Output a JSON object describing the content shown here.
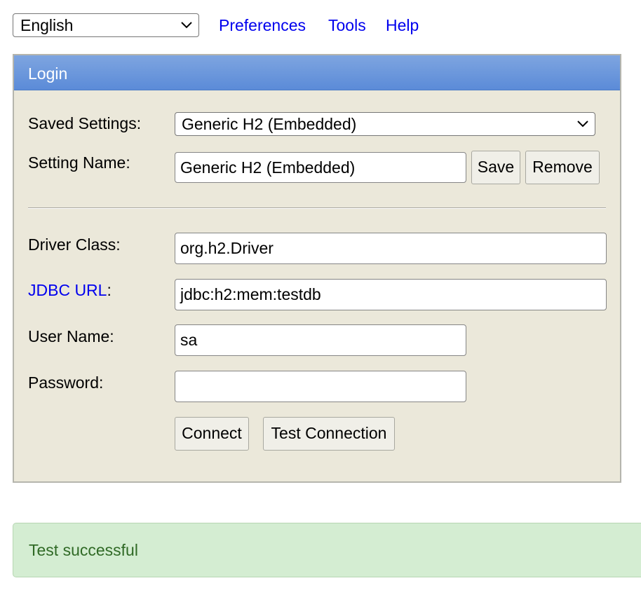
{
  "language_select": {
    "value": "English"
  },
  "nav_links": {
    "preferences": "Preferences",
    "tools": "Tools",
    "help": "Help"
  },
  "login_panel": {
    "title": "Login",
    "saved_settings": {
      "label": "Saved Settings:",
      "value": "Generic H2 (Embedded)"
    },
    "setting_name": {
      "label": "Setting Name:",
      "value": "Generic H2 (Embedded)",
      "save_label": "Save",
      "remove_label": "Remove"
    },
    "driver_class": {
      "label": "Driver Class:",
      "value": "org.h2.Driver"
    },
    "jdbc_url": {
      "label_link": "JDBC URL",
      "label_suffix": ":",
      "value": "jdbc:h2:mem:testdb"
    },
    "user_name": {
      "label": "User Name:",
      "value": "sa"
    },
    "password": {
      "label": "Password:",
      "value": ""
    },
    "connect_label": "Connect",
    "test_connection_label": "Test Connection"
  },
  "status_message": "Test successful",
  "colors": {
    "header_blue": "#6b97dc",
    "panel_bg": "#ebe8da",
    "link": "#0000ee",
    "success_bg": "#d4edd2",
    "success_text": "#306a26"
  }
}
